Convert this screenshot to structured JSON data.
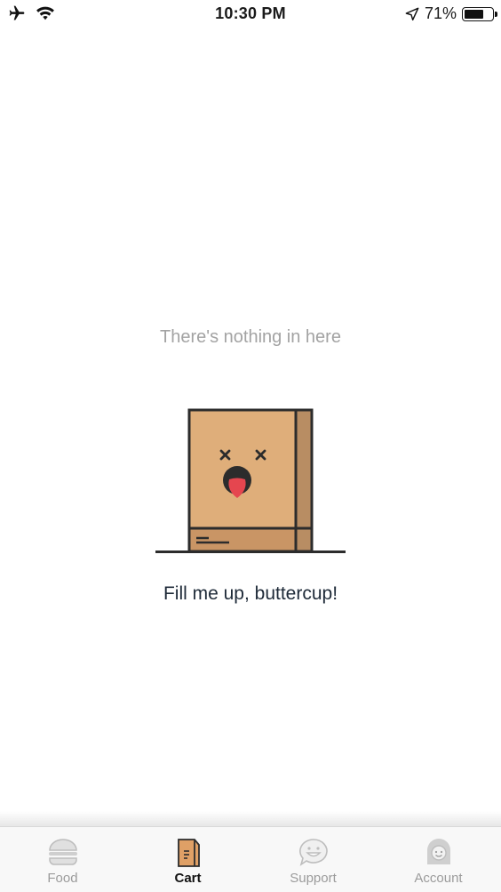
{
  "status_bar": {
    "time": "10:30 PM",
    "battery_percent": "71%",
    "battery_level": 0.71,
    "icons": [
      "airplane-icon",
      "wifi-icon",
      "location-arrow-icon",
      "battery-icon"
    ]
  },
  "empty_state": {
    "title": "There's nothing in here",
    "subtitle": "Fill me up, buttercup!",
    "illustration": "sad-shopping-bag",
    "colors": {
      "bag_front": "#dfae7a",
      "bag_side": "#b88d63",
      "bag_bottom": "#c99565",
      "tongue": "#e5464f",
      "outline": "#2c2c2c"
    }
  },
  "tab_bar": {
    "active": "cart",
    "tabs": [
      {
        "id": "food",
        "label": "Food",
        "icon": "burger-icon"
      },
      {
        "id": "cart",
        "label": "Cart",
        "icon": "bag-icon"
      },
      {
        "id": "support",
        "label": "Support",
        "icon": "chat-bubble-icon"
      },
      {
        "id": "account",
        "label": "Account",
        "icon": "user-icon"
      }
    ]
  }
}
